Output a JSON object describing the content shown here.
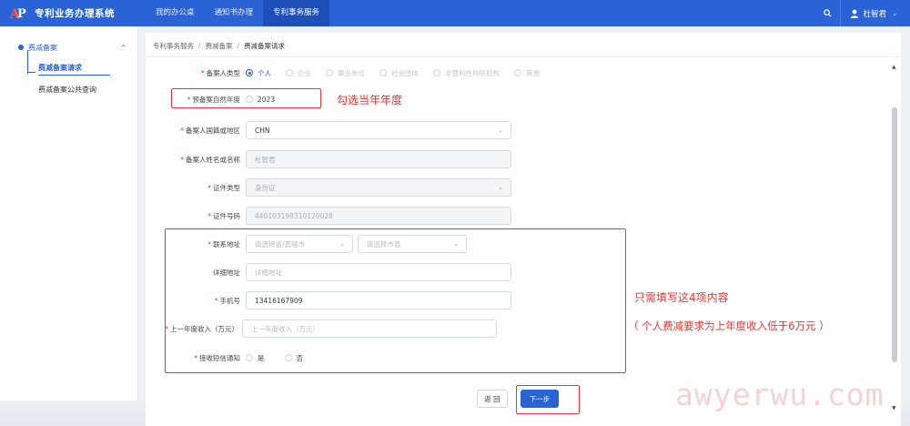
{
  "header": {
    "brand_title": "专利业务办理系统",
    "nav": [
      "我的办公桌",
      "通知书办理",
      "专利事务服务"
    ],
    "active_nav": 2,
    "user_name": "杜智君"
  },
  "sidebar": {
    "group_label": "费减备案",
    "items": [
      {
        "label": "费减备案请求",
        "active": true
      },
      {
        "label": "费减备案公共查询",
        "active": false
      }
    ]
  },
  "breadcrumb": [
    "专利事务服务",
    "费减备案",
    "费减备案请求"
  ],
  "form": {
    "applicant_type": {
      "label": "备案人类型",
      "options": [
        "个人",
        "企业",
        "事业单位",
        "社会团体",
        "非营利性科研机构",
        "其他"
      ],
      "selected": "个人"
    },
    "year": {
      "label": "预备案自然年度",
      "value": "2023"
    },
    "nationality": {
      "label": "备案人国籍或地区",
      "value": "CHN"
    },
    "name": {
      "label": "备案人姓名或名称",
      "value": "杜智君"
    },
    "id_type": {
      "label": "证件类型",
      "value": "身份证"
    },
    "id_number": {
      "label": "证件号码",
      "value": "440103198310120028"
    },
    "address": {
      "label": "联系地址",
      "province_placeholder": "请选择省/直辖市",
      "city_placeholder": "请选择市县"
    },
    "detail_address": {
      "label": "详细地址",
      "placeholder": "详细地址"
    },
    "phone": {
      "label": "手机号",
      "value": "13416167909"
    },
    "income": {
      "label": "上一年度收入（万元）",
      "placeholder": "上一年度收入（万元）"
    },
    "sms": {
      "label": "接收短信通知",
      "options": [
        "是",
        "否"
      ]
    }
  },
  "buttons": {
    "back": "返 回",
    "next": "下一步"
  },
  "annotations": {
    "year_note": "勾选当年年度",
    "fill_note": "只需填写这4项内容",
    "income_note": "（ 个人费减要求为上年度收入低于6万元 ）"
  },
  "watermark": "awyerwu.com",
  "colors": {
    "primary": "#2a63d6",
    "annotation": "#e53935"
  }
}
